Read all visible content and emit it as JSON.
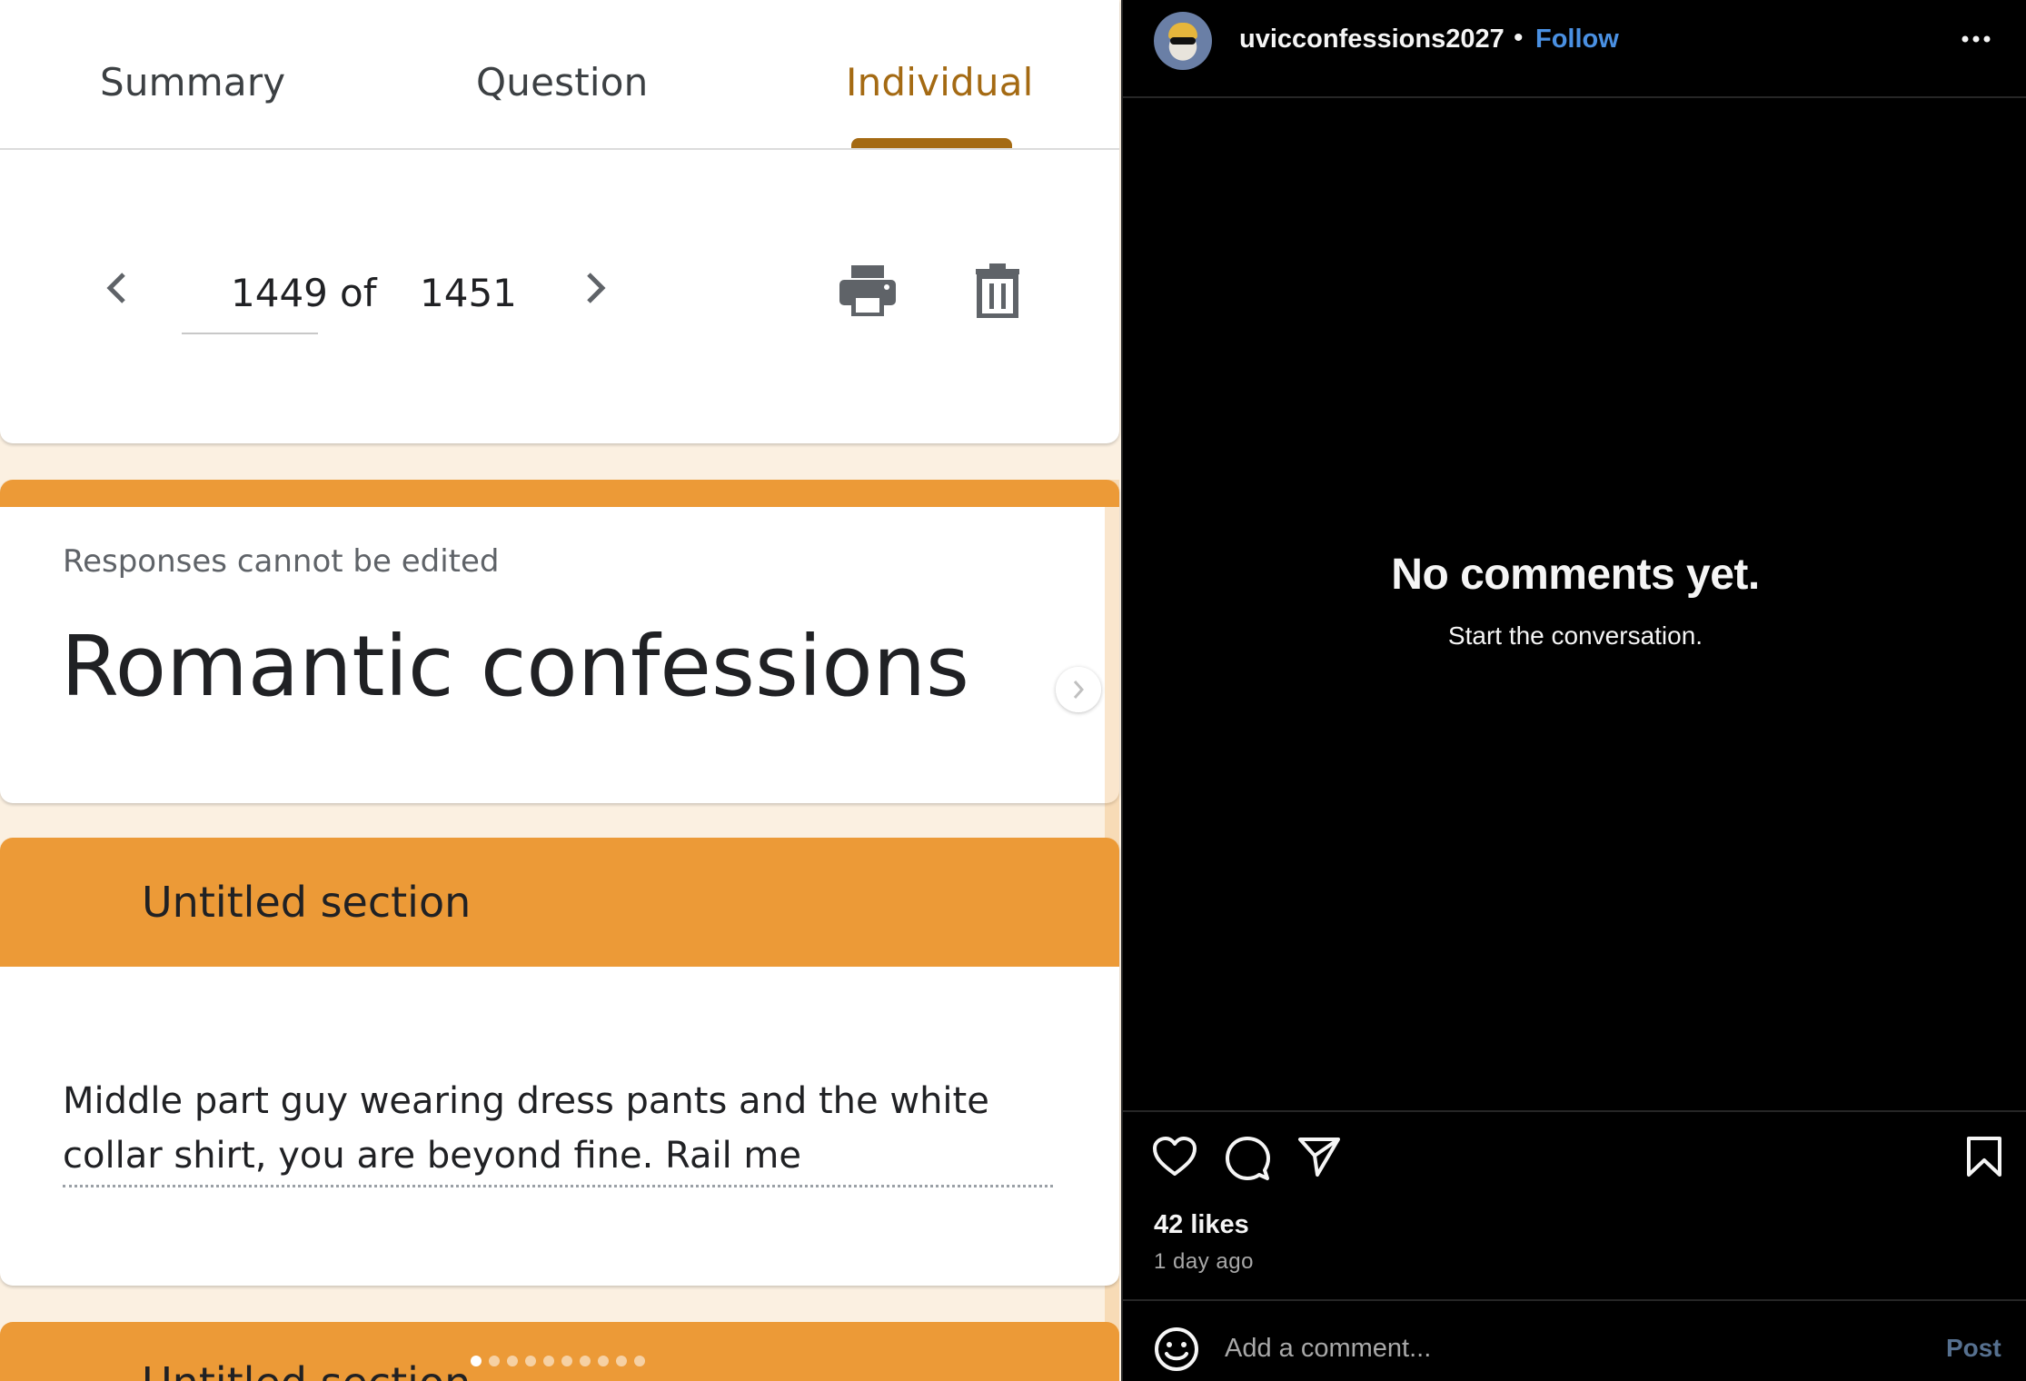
{
  "form": {
    "tabs": [
      {
        "label": "Summary"
      },
      {
        "label": "Question"
      },
      {
        "label": "Individual"
      }
    ],
    "pager": {
      "current": "1449",
      "of": "of",
      "total": "1451"
    },
    "note": "Responses cannot be edited",
    "title": "Romantic confessions",
    "sections": [
      {
        "title": "Untitled section",
        "answer": "Middle part guy wearing dress pants and the white collar shirt, you are beyond fine. Rail me"
      },
      {
        "title": "Untitled section"
      }
    ],
    "accent_color": "#ec9a37",
    "tab_active_color": "#a46a13"
  },
  "instagram": {
    "username": "uvicconfessions2027",
    "separator": "•",
    "follow_label": "Follow",
    "empty_title": "No comments yet.",
    "empty_subtitle": "Start the conversation.",
    "likes": "42 likes",
    "time_ago": "1 day ago",
    "comment_placeholder": "Add a comment...",
    "post_label": "Post",
    "carousel": {
      "count": 10,
      "active_index": 0
    }
  }
}
